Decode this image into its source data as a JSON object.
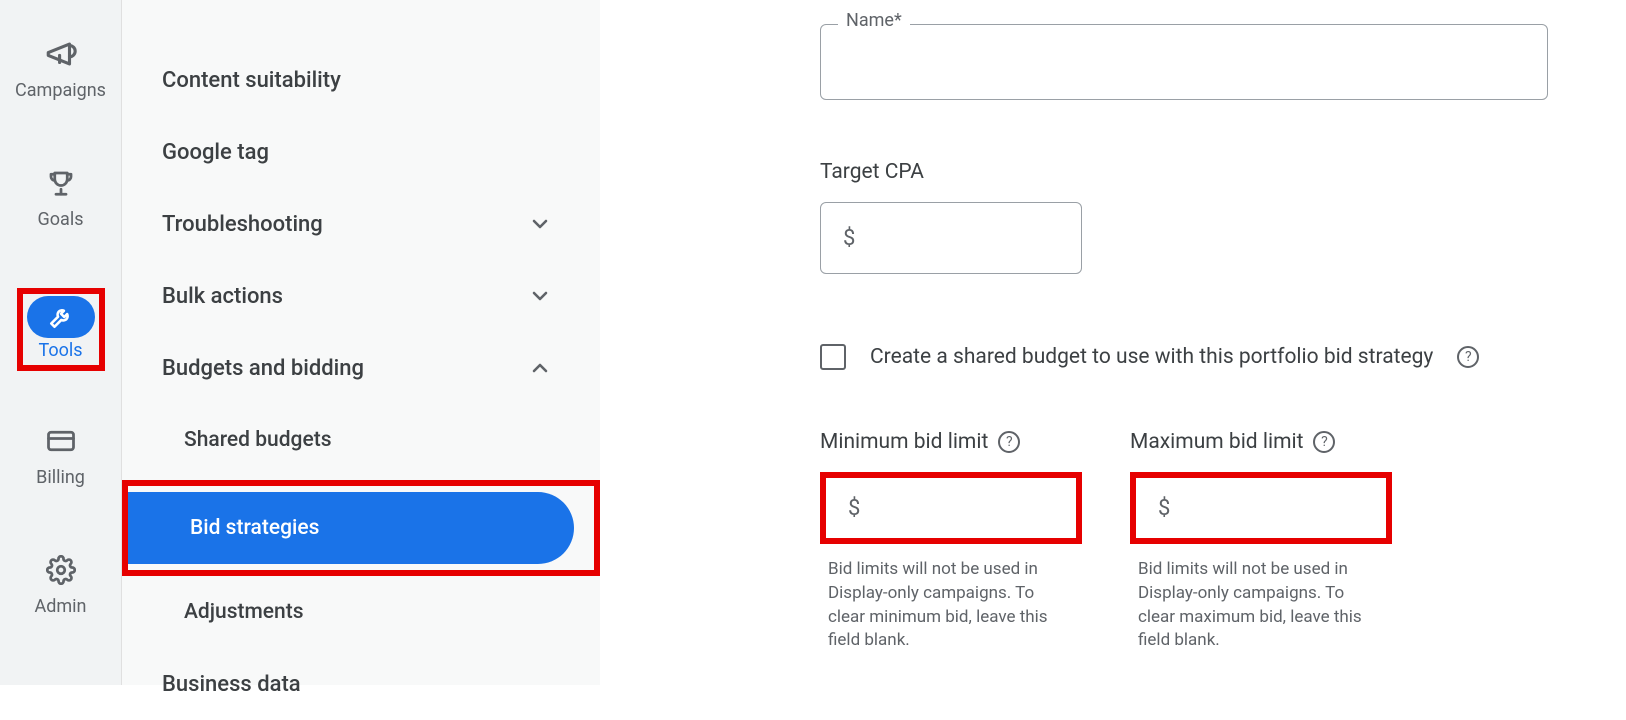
{
  "rail": {
    "items": [
      {
        "label": "Campaigns",
        "icon": "bullhorn"
      },
      {
        "label": "Goals",
        "icon": "trophy"
      },
      {
        "label": "Tools",
        "icon": "wrench",
        "active": true,
        "highlighted": true
      },
      {
        "label": "Billing",
        "icon": "card"
      },
      {
        "label": "Admin",
        "icon": "gear"
      }
    ]
  },
  "panel": {
    "items": [
      {
        "label": "Content suitability"
      },
      {
        "label": "Google tag"
      },
      {
        "label": "Troubleshooting",
        "chevron": "down"
      },
      {
        "label": "Bulk actions",
        "chevron": "down"
      },
      {
        "label": "Budgets and bidding",
        "chevron": "up",
        "children": [
          {
            "label": "Shared budgets"
          },
          {
            "label": "Bid strategies",
            "active": true,
            "highlighted": true
          },
          {
            "label": "Adjustments"
          }
        ]
      },
      {
        "label": "Business data"
      }
    ]
  },
  "form": {
    "name_label": "Name*",
    "name_value": "",
    "target_cpa_label": "Target CPA",
    "target_cpa_prefix": "$",
    "shared_budget_checkbox_label": "Create a shared budget to use with this portfolio bid strategy",
    "min_bid_label": "Minimum bid limit",
    "max_bid_label": "Maximum bid limit",
    "bid_prefix": "$",
    "min_bid_help": "Bid limits will not be used in Display-only campaigns. To clear minimum bid, leave this field blank.",
    "max_bid_help": "Bid limits will not be used in Display-only campaigns. To clear maximum bid, leave this field blank."
  },
  "annotations": {
    "highlighted_elements": [
      "rail-tools",
      "bid-strategies-subitem",
      "min-bid-input",
      "max-bid-input"
    ]
  }
}
